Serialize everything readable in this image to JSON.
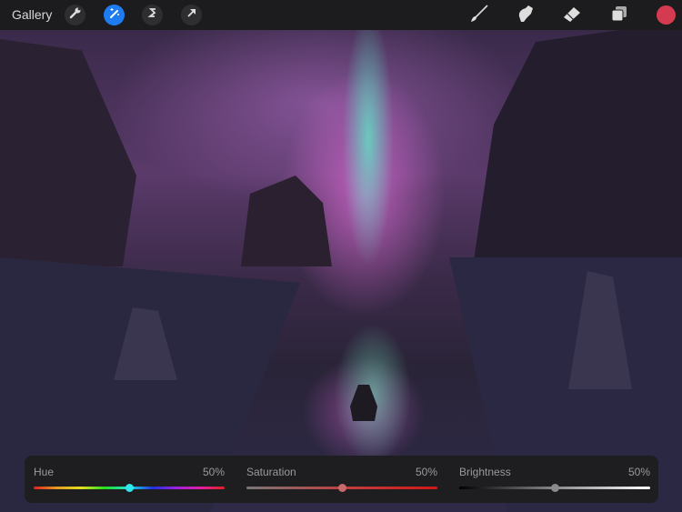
{
  "toolbar": {
    "gallery_label": "Gallery",
    "left_tools": [
      "wrench-icon",
      "magic-wand-icon",
      "selection-icon",
      "transform-arrow-icon"
    ],
    "active_tool": "magic-wand-icon",
    "right_tools": [
      "brush-icon",
      "smudge-icon",
      "eraser-icon",
      "layers-icon"
    ],
    "current_color": "#d43b50"
  },
  "adjustments": {
    "hue": {
      "label": "Hue",
      "value_text": "50%",
      "value": 0.5,
      "knob_color": "#2ee8f0"
    },
    "saturation": {
      "label": "Saturation",
      "value_text": "50%",
      "value": 0.5,
      "knob_color": "#c86a6a"
    },
    "brightness": {
      "label": "Brightness",
      "value_text": "50%",
      "value": 0.5,
      "knob_color": "#8a8a8a"
    }
  }
}
